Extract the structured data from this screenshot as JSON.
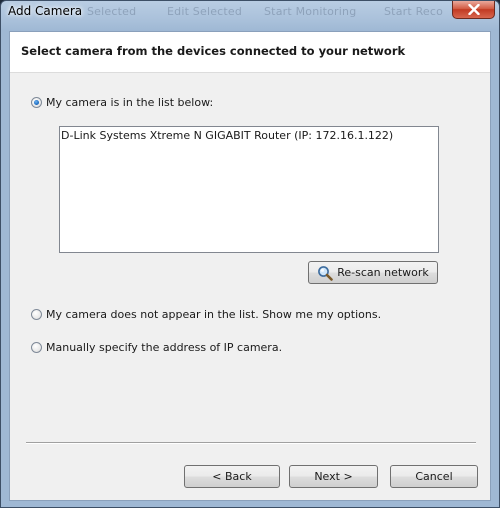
{
  "window": {
    "title": "Add Camera",
    "background_toolbar_ghost": [
      "Selected",
      "Edit Selected",
      "Start Monitoring",
      "Start Reco"
    ]
  },
  "header": {
    "title": "Select camera from the devices connected to your network"
  },
  "options": {
    "in_list_label": "My camera is in the list below:",
    "not_in_list_label": "My camera does not appear in the list. Show me my options.",
    "manual_label": "Manually specify the address of IP camera.",
    "selected": "in_list"
  },
  "device_list": {
    "items": [
      "D-Link Systems Xtreme N GIGABIT Router (IP: 172.16.1.122)"
    ]
  },
  "buttons": {
    "rescan_label": "Re-scan network",
    "back_label": "< Back",
    "next_label": "Next >",
    "cancel_label": "Cancel"
  },
  "icons": {
    "close": "close-icon",
    "rescan": "magnifier-icon"
  },
  "colors": {
    "accent": "#1f6fc4",
    "close_button": "#c13a23"
  }
}
